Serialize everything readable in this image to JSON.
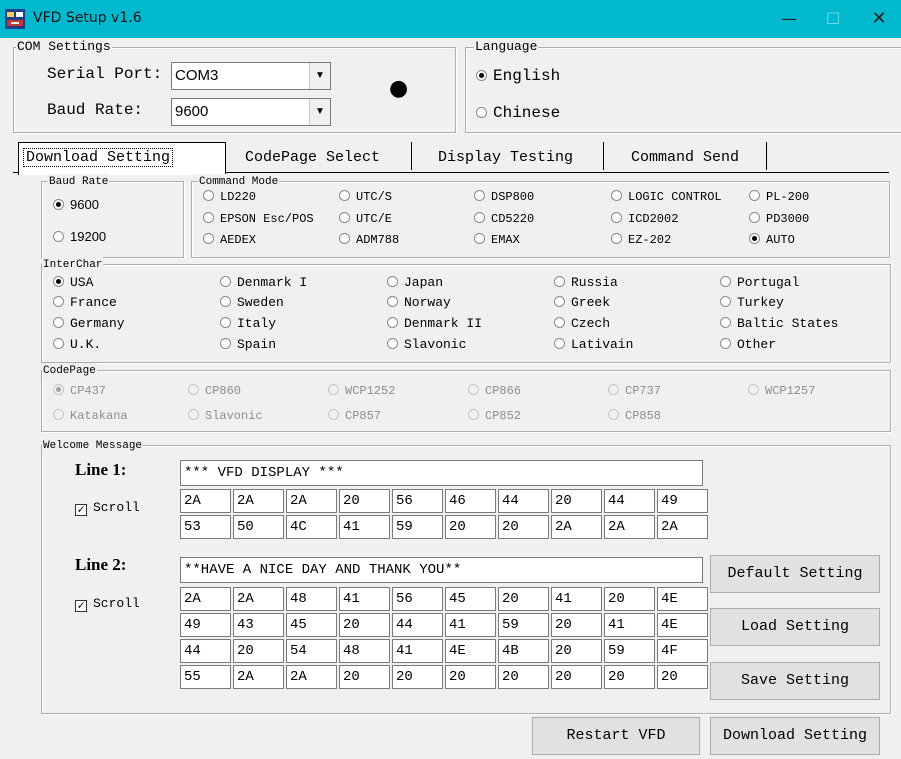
{
  "window": {
    "title": "VFD Setup v1.6",
    "minimize_glyph": "—",
    "maximize_glyph": "☐",
    "close_glyph": "✕",
    "titlebar_color": "#00b9cf"
  },
  "com_settings": {
    "legend": "COM Settings",
    "serial_port_label": "Serial Port:",
    "serial_port_value": "COM3",
    "baud_rate_label": "Baud Rate:",
    "baud_rate_value": "9600",
    "dropdown_glyph": "▼",
    "status_indicator": "●"
  },
  "language": {
    "legend": "Language",
    "english": "English",
    "chinese": "Chinese",
    "selected": "English"
  },
  "tabs": [
    "Download Setting",
    "CodePage Select",
    "Display Testing",
    "Command Send"
  ],
  "active_tab": "Download Setting",
  "baud_rate": {
    "legend": "Baud Rate",
    "options": [
      "9600",
      "19200"
    ],
    "selected": "9600"
  },
  "command_mode": {
    "legend": "Command Mode",
    "options": [
      "LD220",
      "UTC/S",
      "DSP800",
      "LOGIC CONTROL",
      "PL-200",
      "EPSON Esc/POS",
      "UTC/E",
      "CD5220",
      "ICD2002",
      "PD3000",
      "AEDEX",
      "ADM788",
      "EMAX",
      "EZ-202",
      "AUTO"
    ],
    "selected": "AUTO"
  },
  "interchar": {
    "legend": "InterChar",
    "options": [
      "USA",
      "Denmark I",
      "Japan",
      "Russia",
      "Portugal",
      "France",
      "Sweden",
      "Norway",
      "Greek",
      "Turkey",
      "Germany",
      "Italy",
      "Denmark II",
      "Czech",
      "Baltic States",
      "U.K.",
      "Spain",
      "Slavonic",
      "Lativain",
      "Other"
    ],
    "selected": "USA"
  },
  "codepage": {
    "legend": "CodePage",
    "options": [
      "CP437",
      "CP860",
      "WCP1252",
      "CP866",
      "CP737",
      "WCP1257",
      "Katakana",
      "Slavonic",
      "CP857",
      "CP852",
      "CP858"
    ],
    "selected": "CP437",
    "disabled": true
  },
  "welcome": {
    "legend": "Welcome Message",
    "line1": {
      "label": "Line 1:",
      "scroll_label": "Scroll",
      "scroll_checked": true,
      "text": "*** VFD DISPLAY  ***",
      "hex": [
        "2A",
        "2A",
        "2A",
        "20",
        "56",
        "46",
        "44",
        "20",
        "44",
        "49",
        "53",
        "50",
        "4C",
        "41",
        "59",
        "20",
        "20",
        "2A",
        "2A",
        "2A"
      ]
    },
    "line2": {
      "label": "Line 2:",
      "scroll_label": "Scroll",
      "scroll_checked": true,
      "text": "**HAVE A NICE DAY AND THANK YOU**",
      "hex": [
        "2A",
        "2A",
        "48",
        "41",
        "56",
        "45",
        "20",
        "41",
        "20",
        "4E",
        "49",
        "43",
        "45",
        "20",
        "44",
        "41",
        "59",
        "20",
        "41",
        "4E",
        "44",
        "20",
        "54",
        "48",
        "41",
        "4E",
        "4B",
        "20",
        "59",
        "4F",
        "55",
        "2A",
        "2A",
        "20",
        "20",
        "20",
        "20",
        "20",
        "20",
        "20"
      ]
    },
    "check_glyph": "✓"
  },
  "buttons": {
    "default_setting": "Default Setting",
    "load_setting": "Load Setting",
    "save_setting": "Save Setting",
    "restart_vfd": "Restart VFD",
    "download_setting": "Download Setting"
  }
}
